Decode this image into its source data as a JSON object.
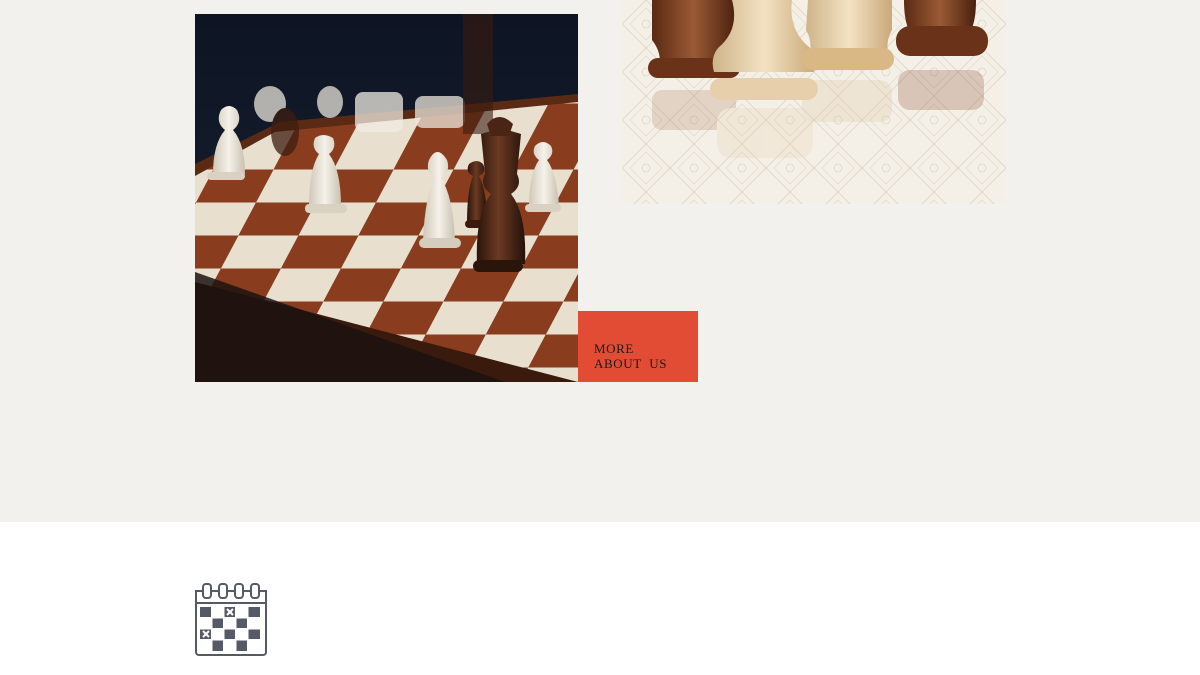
{
  "about_section": {
    "cta": {
      "line1": "MORE",
      "line2": "ABOUT  US"
    },
    "accent_color": "#e24c34",
    "background_color": "#f3f1ee"
  },
  "images": {
    "main_photo": "chessboard-photo",
    "pieces_photo": "chess-pieces-photo"
  },
  "icons": {
    "calendar": "calendar-icon"
  }
}
